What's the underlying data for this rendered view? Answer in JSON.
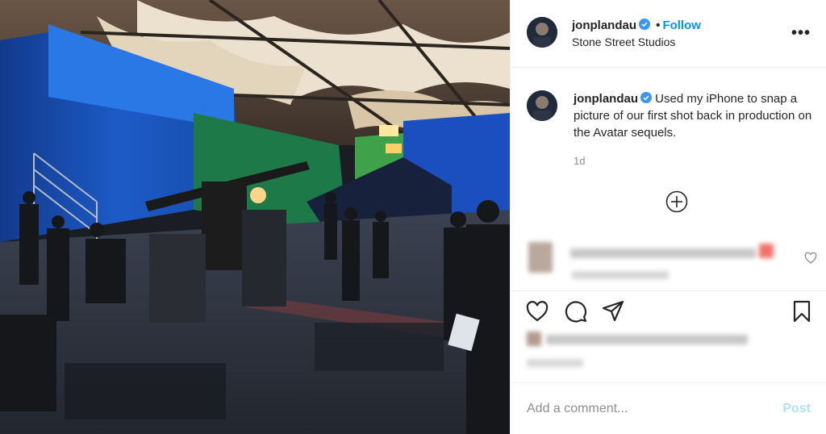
{
  "post": {
    "username": "jonplandau",
    "follow_label": "Follow",
    "separator": "•",
    "location": "Stone Street Studios",
    "more_label": "•••",
    "caption_username": "jonplandau",
    "caption_text": "Used my iPhone to snap a picture of our first shot back in production on the Avatar sequels.",
    "timestamp": "1d",
    "comment_placeholder": "Add a comment...",
    "post_label": "Post"
  },
  "icons": {
    "verified": "verified-badge-icon",
    "load_more": "plus-circle-icon",
    "like": "heart-icon",
    "comment": "speech-bubble-icon",
    "share": "paper-plane-icon",
    "save": "bookmark-icon",
    "comment_like": "small-heart-icon"
  },
  "colors": {
    "accent": "#0095f6",
    "post_disabled": "#b2dffc",
    "verified": "#3897f0",
    "muted": "#8e8e8e"
  }
}
